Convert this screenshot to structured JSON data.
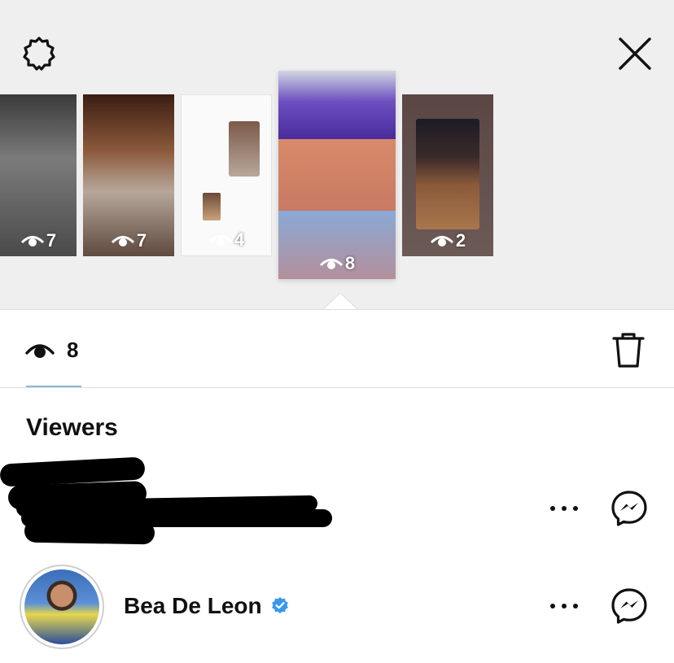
{
  "stories": [
    {
      "views": "7"
    },
    {
      "views": "7"
    },
    {
      "views": "4"
    },
    {
      "views": "8",
      "selected": true
    },
    {
      "views": "2"
    }
  ],
  "stats": {
    "view_count": "8"
  },
  "viewers_section": {
    "title": "Viewers",
    "viewers": [
      {
        "name": "",
        "redacted": true
      },
      {
        "name": "Bea De Leon",
        "verified": true
      }
    ]
  },
  "icons": {
    "settings": "gear-icon",
    "close": "close-icon",
    "views": "eye-icon",
    "delete": "trash-icon",
    "more": "more-horizontal-icon",
    "message": "messenger-icon",
    "verified": "verified-badge-icon"
  },
  "colors": {
    "top_background": "#efefef",
    "tab_underline": "#8fb8cf",
    "verified_blue": "#3897f0"
  }
}
